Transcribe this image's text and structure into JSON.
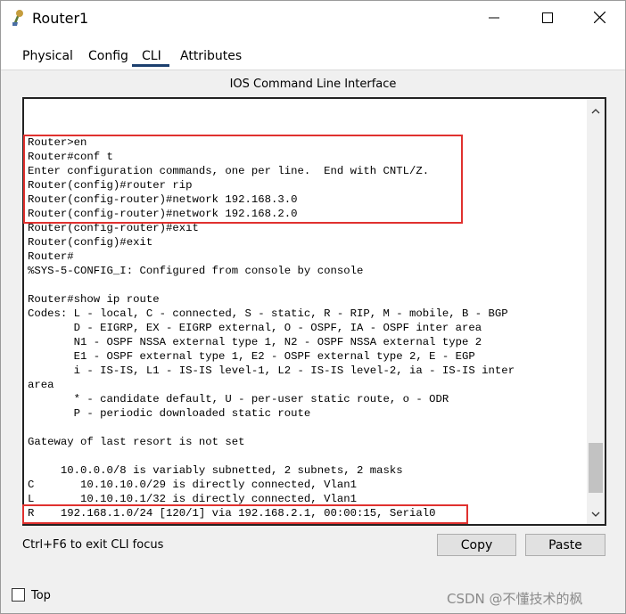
{
  "window": {
    "title": "Router1",
    "controls": {
      "minimize": "minimize-icon",
      "maximize": "maximize-icon",
      "close": "close-icon"
    }
  },
  "tabs": [
    {
      "label": "Physical"
    },
    {
      "label": "Config"
    },
    {
      "label": "CLI",
      "active": true
    },
    {
      "label": "Attributes"
    }
  ],
  "cli": {
    "header": "IOS Command Line Interface",
    "lines": [
      "Router>en",
      "Router#conf t",
      "Enter configuration commands, one per line.  End with CNTL/Z.",
      "Router(config)#router rip",
      "Router(config-router)#network 192.168.3.0",
      "Router(config-router)#network 192.168.2.0",
      "Router(config-router)#exit",
      "Router(config)#exit",
      "Router#",
      "%SYS-5-CONFIG_I: Configured from console by console",
      "",
      "Router#show ip route",
      "Codes: L - local, C - connected, S - static, R - RIP, M - mobile, B - BGP",
      "       D - EIGRP, EX - EIGRP external, O - OSPF, IA - OSPF inter area",
      "       N1 - OSPF NSSA external type 1, N2 - OSPF NSSA external type 2",
      "       E1 - OSPF external type 1, E2 - OSPF external type 2, E - EGP",
      "       i - IS-IS, L1 - IS-IS level-1, L2 - IS-IS level-2, ia - IS-IS inter",
      "area",
      "       * - candidate default, U - per-user static route, o - ODR",
      "       P - periodic downloaded static route",
      "",
      "Gateway of last resort is not set",
      "",
      "     10.0.0.0/8 is variably subnetted, 2 subnets, 2 masks",
      "C       10.10.10.0/29 is directly connected, Vlan1",
      "L       10.10.10.1/32 is directly connected, Vlan1",
      "R    192.168.1.0/24 [120/1] via 192.168.2.1, 00:00:15, Serial0"
    ]
  },
  "footer": {
    "hint": "Ctrl+F6 to exit CLI focus",
    "copy_label": "Copy",
    "paste_label": "Paste",
    "top_label": "Top",
    "top_checked": false
  },
  "watermark": "CSDN @不懂技术的枫",
  "colors": {
    "highlight_border": "#e0312f",
    "active_tab_underline": "#1c3f6e",
    "button_bg": "#e1e1e1"
  }
}
